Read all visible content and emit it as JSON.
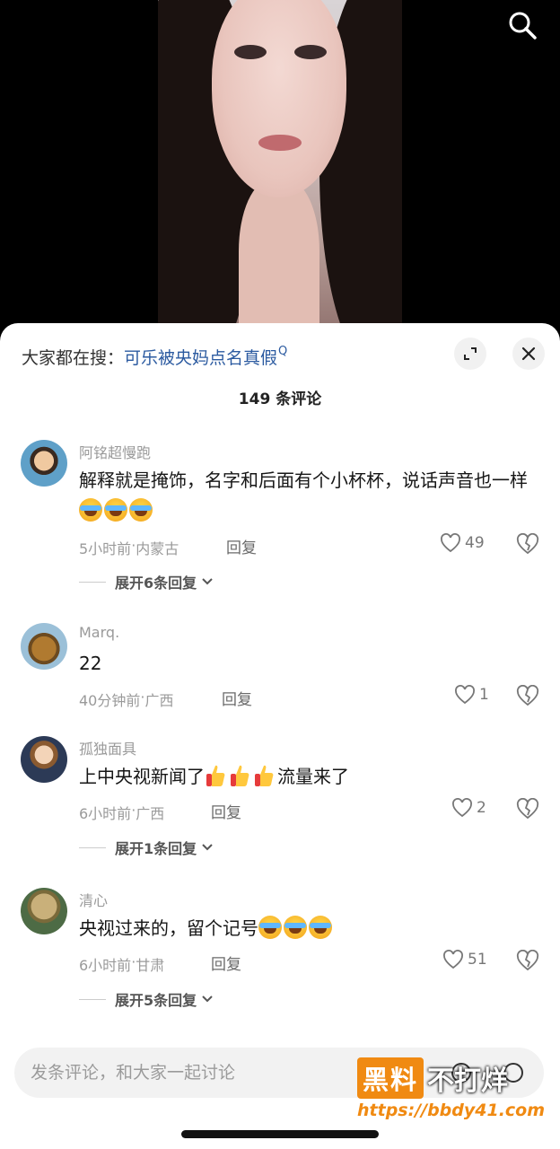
{
  "video": {
    "search_icon": "search-icon"
  },
  "sheet": {
    "trend_prefix": "大家都在搜：",
    "trend_query": "可乐被央妈点名真假",
    "trend_icon": "Q",
    "comment_count": "149 条评论"
  },
  "comments": [
    {
      "username": "阿铭超慢跑",
      "text": "解释就是掩饰，名字和后面有个小杯杯，说话声音也一样",
      "emoji": [
        "crying-laughing-emoji",
        "crying-laughing-emoji",
        "crying-laughing-emoji"
      ],
      "time": "5小时前",
      "location": "内蒙古",
      "reply_label": "回复",
      "likes": "49",
      "expand_label": "展开6条回复"
    },
    {
      "username": "Marq.",
      "text": "22",
      "time": "40分钟前",
      "location": "广西",
      "reply_label": "回复",
      "likes": "1"
    },
    {
      "username": "孤独面具",
      "text_before": "上中央视新闻了",
      "emoji": [
        "thumbs-up-emoji",
        "thumbs-up-emoji",
        "thumbs-up-emoji"
      ],
      "text_after": "流量来了",
      "time": "6小时前",
      "location": "广西",
      "reply_label": "回复",
      "likes": "2",
      "expand_label": "展开1条回复"
    },
    {
      "username": "清心",
      "text": "央视过来的，留个记号",
      "emoji": [
        "crying-laughing-emoji",
        "crying-laughing-emoji",
        "crying-laughing-emoji"
      ],
      "time": "6小时前",
      "location": "甘肃",
      "reply_label": "回复",
      "likes": "51",
      "expand_label": "展开5条回复"
    }
  ],
  "input": {
    "placeholder": "发条评论，和大家一起讨论"
  },
  "watermark": {
    "box_text": "黑料",
    "right_text": "不打烊",
    "url": "https://bbdy41.com"
  },
  "colors": {
    "link": "#2b5aa0",
    "watermark": "#f08a12"
  }
}
